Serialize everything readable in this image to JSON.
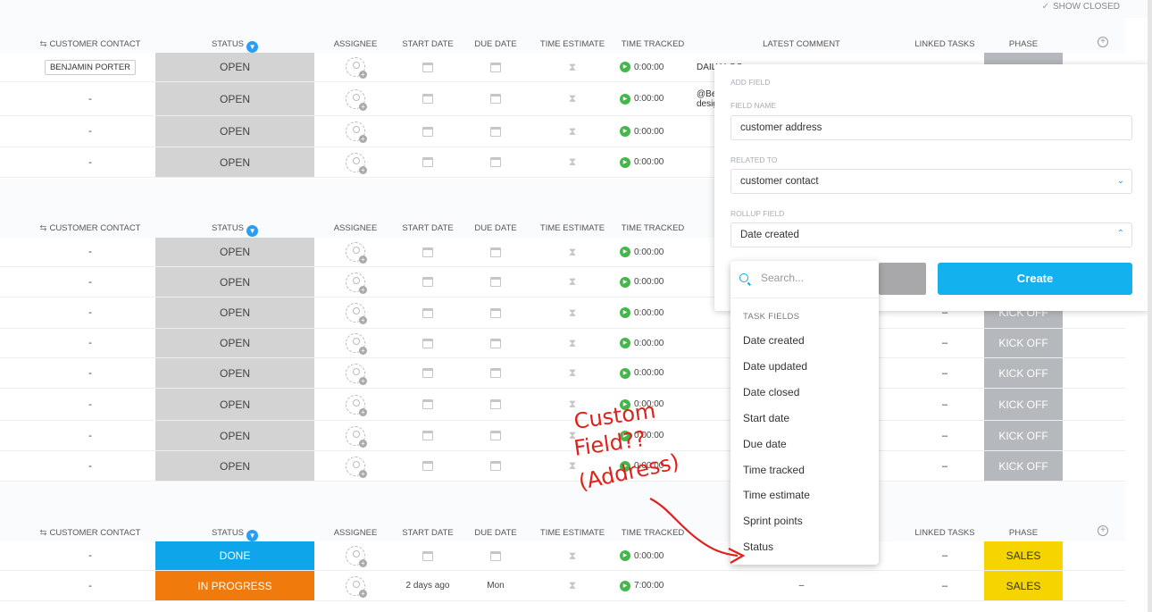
{
  "header": {
    "show_closed": "SHOW CLOSED"
  },
  "columns": {
    "customer_contact": "CUSTOMER CONTACT",
    "status": "STATUS",
    "assignee": "ASSIGNEE",
    "start_date": "START DATE",
    "due_date": "DUE DATE",
    "time_estimate": "TIME ESTIMATE",
    "time_tracked": "TIME TRACKED",
    "latest_comment": "LATEST COMMENT",
    "linked_tasks": "LINKED TASKS",
    "phase": "PHASE"
  },
  "groups": [
    {
      "rows": [
        {
          "contact": "BENJAMIN PORTER",
          "status": "OPEN",
          "time": "0:00:00",
          "comment": "DAILY LOG"
        },
        {
          "contact": "-",
          "status": "OPEN",
          "time": "0:00:00",
          "comment": "@Be\ndesig"
        },
        {
          "contact": "-",
          "status": "OPEN",
          "time": "0:00:00"
        },
        {
          "contact": "-",
          "status": "OPEN",
          "time": "0:00:00"
        }
      ]
    },
    {
      "rows": [
        {
          "contact": "-",
          "status": "OPEN",
          "time": "0:00:00"
        },
        {
          "contact": "-",
          "status": "OPEN",
          "time": "0:00:00"
        },
        {
          "contact": "-",
          "status": "OPEN",
          "time": "0:00:00",
          "linked": "–",
          "phase": "KICK OFF"
        },
        {
          "contact": "-",
          "status": "OPEN",
          "time": "0:00:00",
          "linked": "–",
          "phase": "KICK OFF"
        },
        {
          "contact": "-",
          "status": "OPEN",
          "time": "0:00:00",
          "linked": "–",
          "phase": "KICK OFF"
        },
        {
          "contact": "-",
          "status": "OPEN",
          "time": "0:00:00",
          "linked": "–",
          "phase": "KICK OFF"
        },
        {
          "contact": "-",
          "status": "OPEN",
          "time": "0:00:00",
          "linked": "–",
          "phase": "KICK OFF"
        },
        {
          "contact": "-",
          "status": "OPEN",
          "time": "0:00:00",
          "linked": "–",
          "phase": "KICK OFF"
        }
      ]
    },
    {
      "rows": [
        {
          "contact": "-",
          "status": "DONE",
          "time": "0:00:00",
          "linked": "–",
          "phase": "SALES"
        },
        {
          "contact": "-",
          "status": "IN PROGRESS",
          "start": "2 days ago",
          "due": "Mon",
          "time": "7:00:00",
          "comment": "–",
          "linked": "–",
          "phase": "SALES"
        }
      ]
    }
  ],
  "add_field": {
    "title": "ADD FIELD",
    "field_name_label": "FIELD NAME",
    "field_name_value": "customer address",
    "related_to_label": "RELATED TO",
    "related_to_value": "customer contact",
    "rollup_label": "ROLLUP FIELD",
    "rollup_value": "Date created",
    "create_label": "Create"
  },
  "dropdown": {
    "search_placeholder": "Search...",
    "group_label": "TASK FIELDS",
    "items": [
      "Date created",
      "Date updated",
      "Date closed",
      "Start date",
      "Due date",
      "Time tracked",
      "Time estimate",
      "Sprint points",
      "Status"
    ]
  },
  "colors": {
    "open": "#d3d3d3",
    "done": "#0ea5ea",
    "in_progress": "#f07a0c",
    "kick_off": "#b5b8bc",
    "sales": "#f5d400",
    "create": "#13b2ee",
    "annotation": "#e0211b"
  },
  "annotation": {
    "text": [
      "Custom",
      "Field??",
      "(Address)"
    ]
  }
}
